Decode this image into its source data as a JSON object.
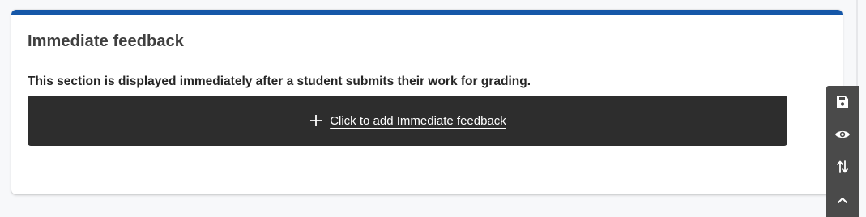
{
  "section": {
    "title": "Immediate feedback",
    "description": "This section is displayed immediately after a student submits their work for grading.",
    "add_button_label": "Click to add Immediate feedback",
    "add_icon": "plus-icon"
  },
  "toolbar": {
    "items": [
      {
        "name": "save",
        "icon": "save-icon"
      },
      {
        "name": "preview",
        "icon": "eye-icon"
      },
      {
        "name": "reorder",
        "icon": "swap-vertical-icon"
      },
      {
        "name": "scroll-up",
        "icon": "chevron-up-icon"
      }
    ]
  },
  "colors": {
    "accent_bar": "#1557a8",
    "button_bg": "#2d2d2d",
    "toolbar_bg": "#4a4a4a",
    "page_bg": "#f7f8fa"
  }
}
